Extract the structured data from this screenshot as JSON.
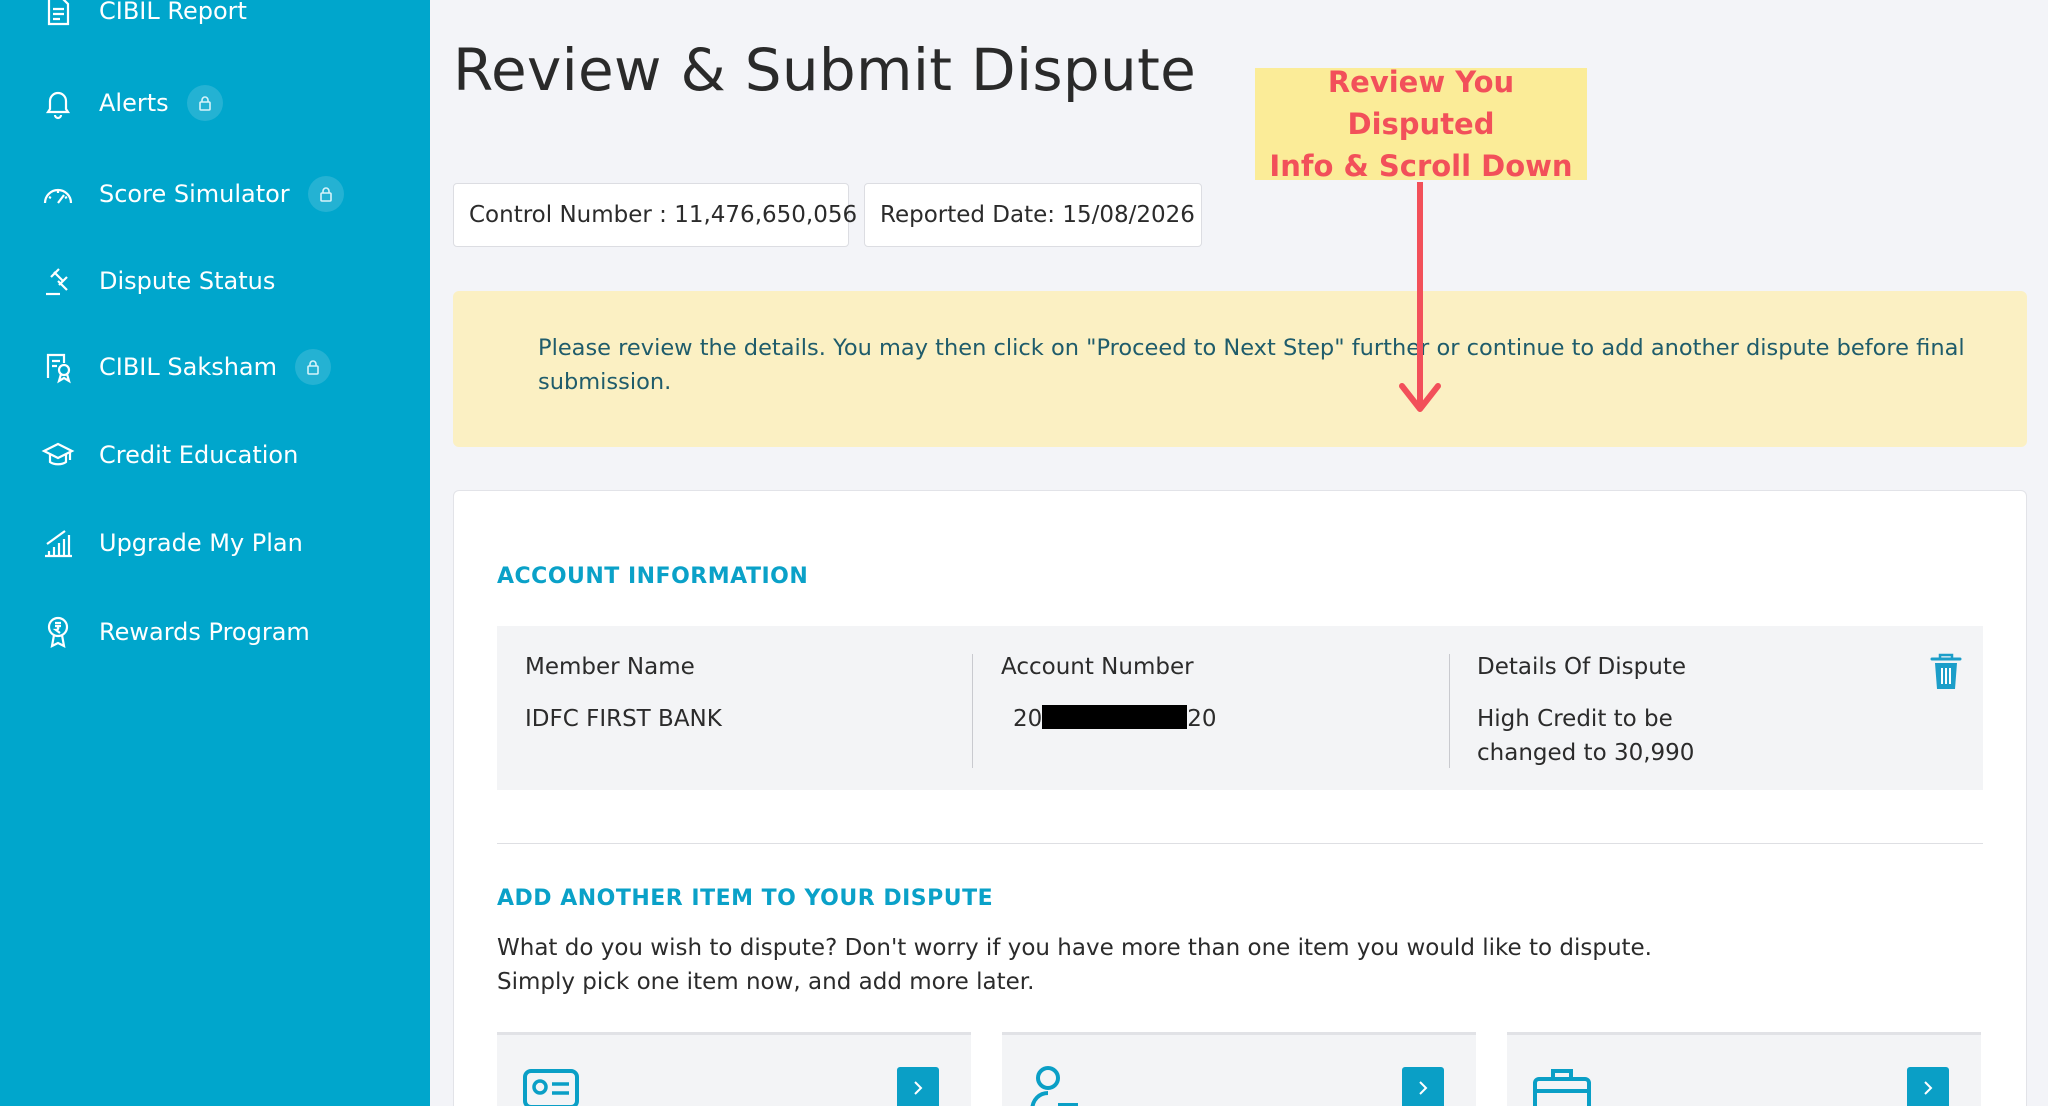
{
  "sidebar": {
    "items": [
      {
        "label": "CIBIL Report",
        "icon": "document-icon",
        "locked": false
      },
      {
        "label": "Alerts",
        "icon": "bell-icon",
        "locked": true
      },
      {
        "label": "Score Simulator",
        "icon": "speedometer-icon",
        "locked": true
      },
      {
        "label": "Dispute Status",
        "icon": "gavel-icon",
        "locked": false
      },
      {
        "label": "CIBIL Saksham",
        "icon": "certificate-icon",
        "locked": true
      },
      {
        "label": "Credit Education",
        "icon": "graduation-cap-icon",
        "locked": false
      },
      {
        "label": "Upgrade My Plan",
        "icon": "growth-chart-icon",
        "locked": false
      },
      {
        "label": "Rewards Program",
        "icon": "rupee-medal-icon",
        "locked": false
      }
    ],
    "lock_icon": "lock-icon"
  },
  "header": {
    "title": "Review & Submit Dispute"
  },
  "meta": {
    "control_number": "Control Number : 11,476,650,056",
    "reported_date": "Reported Date: 15/08/2026"
  },
  "annotation": {
    "line1": "Review You Disputed",
    "line2": "Info & Scroll Down"
  },
  "notice": {
    "text": "Please review the details. You may then click on \"Proceed to Next Step\" further or continue to add another dispute before final submission."
  },
  "account_info": {
    "heading": "ACCOUNT INFORMATION",
    "member_name_label": "Member Name",
    "member_name_value": "IDFC FIRST BANK",
    "account_number_label": "Account Number",
    "account_number_prefix": "20",
    "account_number_suffix": "20",
    "dispute_details_label": "Details Of Dispute",
    "dispute_details_value": "High Credit to be changed to 30,990"
  },
  "add_item": {
    "heading": "ADD ANOTHER ITEM TO YOUR DISPUTE",
    "line1": "What do you wish to dispute? Don't worry if you have more than one item you would like to dispute.",
    "line2": "Simply pick one item now, and add more later.",
    "options": [
      {
        "icon": "id-card-icon"
      },
      {
        "icon": "person-icon"
      },
      {
        "icon": "briefcase-icon"
      }
    ]
  },
  "colors": {
    "sidebar": "#00a6cc",
    "accent": "#0aa1c8",
    "notice_bg": "#fbf0c3",
    "annotation_bg": "#fbec98",
    "annotation_text": "#f2505a"
  }
}
